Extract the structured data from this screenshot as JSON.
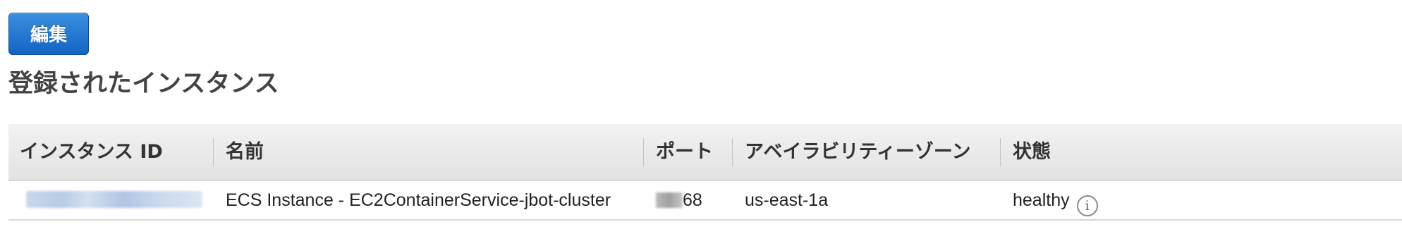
{
  "toolbar": {
    "edit_label": "編集"
  },
  "section": {
    "title": "登録されたインスタンス"
  },
  "table": {
    "columns": [
      "インスタンス ID",
      "名前",
      "ポート",
      "アベイラビリティーゾーン",
      "状態"
    ],
    "rows": [
      {
        "instance_id": "",
        "name": "ECS Instance - EC2ContainerService-jbot-cluster",
        "port_suffix": "68",
        "availability_zone": "us-east-1a",
        "status": "healthy"
      }
    ]
  },
  "icons": {
    "info": "info-icon",
    "info_glyph": "i"
  }
}
